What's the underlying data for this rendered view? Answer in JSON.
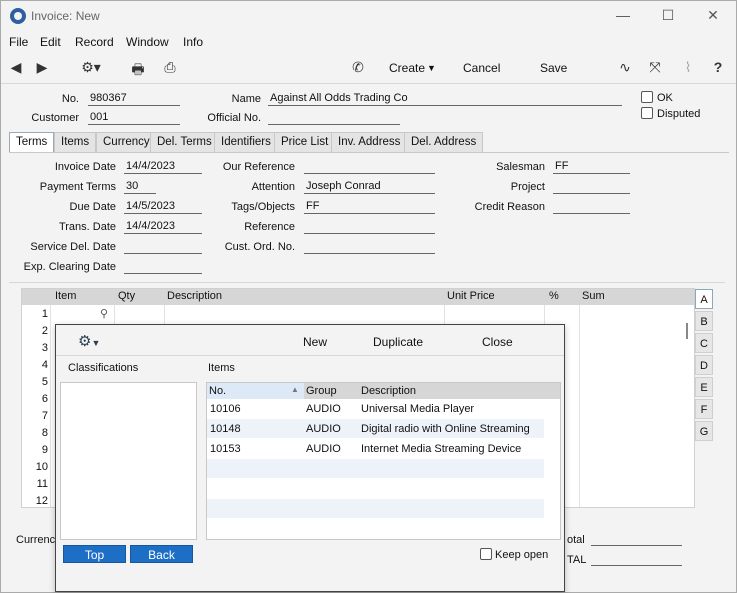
{
  "window": {
    "title": "Invoice: New",
    "minimize": "—",
    "maximize": "☐",
    "close": "✕"
  },
  "menu": [
    "File",
    "Edit",
    "Record",
    "Window",
    "Info"
  ],
  "toolbar": {
    "create": "Create",
    "cancel": "Cancel",
    "save": "Save"
  },
  "header": {
    "no_label": "No.",
    "no_value": "980367",
    "customer_label": "Customer",
    "customer_value": "001",
    "name_label": "Name",
    "name_value": "Against All Odds Trading Co",
    "official_label": "Official No.",
    "official_value": "",
    "ok_label": "OK",
    "disputed_label": "Disputed"
  },
  "tabs": [
    "Terms",
    "Items",
    "Currency",
    "Del. Terms",
    "Identifiers",
    "Price List",
    "Inv. Address",
    "Del. Address"
  ],
  "terms": {
    "invoice_date_label": "Invoice Date",
    "invoice_date": "14/4/2023",
    "payment_terms_label": "Payment Terms",
    "payment_terms": "30",
    "due_date_label": "Due Date",
    "due_date": "14/5/2023",
    "trans_date_label": "Trans. Date",
    "trans_date": "14/4/2023",
    "service_del_label": "Service Del. Date",
    "service_del": "",
    "exp_clearing_label": "Exp. Clearing Date",
    "exp_clearing": "",
    "our_ref_label": "Our Reference",
    "our_ref": "",
    "attention_label": "Attention",
    "attention": "Joseph Conrad",
    "tags_label": "Tags/Objects",
    "tags": "FF",
    "reference_label": "Reference",
    "reference": "",
    "cust_ord_label": "Cust. Ord. No.",
    "cust_ord": "",
    "salesman_label": "Salesman",
    "salesman": "FF",
    "project_label": "Project",
    "project": "",
    "credit_reason_label": "Credit Reason",
    "credit_reason": ""
  },
  "grid": {
    "columns": [
      "Item",
      "Qty",
      "Description",
      "Unit Price",
      "%",
      "Sum"
    ],
    "rows": [
      "1",
      "2",
      "3",
      "4",
      "5",
      "6",
      "7",
      "8",
      "9",
      "10",
      "11",
      "12"
    ],
    "side_tabs": [
      "A",
      "B",
      "C",
      "D",
      "E",
      "F",
      "G"
    ]
  },
  "footer": {
    "currency_label": "Currenc",
    "total_label": "otal",
    "total2_label": "TAL"
  },
  "popup": {
    "new": "New",
    "duplicate": "Duplicate",
    "close": "Close",
    "classifications": "Classifications",
    "items_title": "Items",
    "columns": [
      "No.",
      "Group",
      "Description"
    ],
    "rows": [
      {
        "no": "10106",
        "group": "AUDIO",
        "desc": "Universal Media Player"
      },
      {
        "no": "10148",
        "group": "AUDIO",
        "desc": "Digital radio with Online Streaming"
      },
      {
        "no": "10153",
        "group": "AUDIO",
        "desc": "Internet Media Streaming Device"
      }
    ],
    "top": "Top",
    "back": "Back",
    "keep_open": "Keep open"
  }
}
